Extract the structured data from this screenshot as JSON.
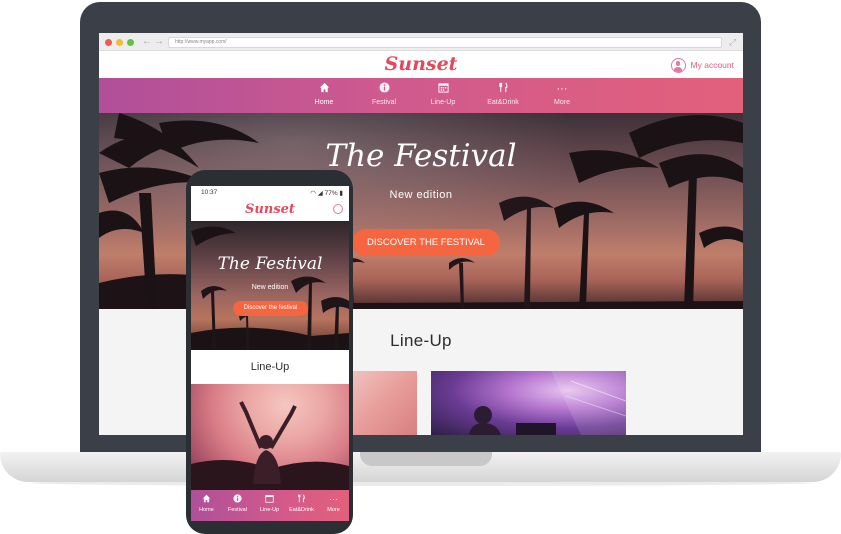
{
  "browser": {
    "url": "http://www.myapp.com/"
  },
  "site": {
    "logo": "Sunset",
    "account_label": "My account",
    "nav": [
      {
        "label": "Home",
        "icon": "home-icon"
      },
      {
        "label": "Festival",
        "icon": "info-icon"
      },
      {
        "label": "Line-Up",
        "icon": "calendar-icon"
      },
      {
        "label": "Eat&Drink",
        "icon": "cutlery-icon"
      },
      {
        "label": "More",
        "icon": "more-icon"
      }
    ],
    "hero": {
      "title": "The Festival",
      "subtitle": "New edition",
      "cta": "DISCOVER THE FESTIVAL"
    },
    "lineup_title": "Line-Up"
  },
  "phone": {
    "time": "10:37",
    "battery": "77%",
    "logo": "Sunset",
    "hero": {
      "title": "The Festival",
      "subtitle": "New edition",
      "cta": "Discover the festival"
    },
    "lineup_title": "Line-Up",
    "tabs": [
      {
        "label": "Home",
        "icon": "home-icon"
      },
      {
        "label": "Festival",
        "icon": "info-icon"
      },
      {
        "label": "Line-Up",
        "icon": "calendar-icon"
      },
      {
        "label": "Eat&Drink",
        "icon": "cutlery-icon"
      },
      {
        "label": "More",
        "icon": "more-icon"
      }
    ]
  },
  "colors": {
    "brand": "#e3485b",
    "nav_start": "#b04f9a",
    "nav_end": "#e3607b",
    "cta": "#f5653f"
  }
}
